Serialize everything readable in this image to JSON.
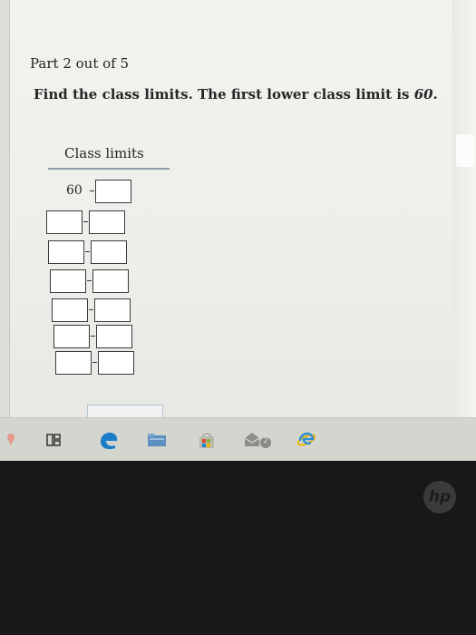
{
  "problem": {
    "part_label": "Part 2 out of 5",
    "question_text": "Find the class limits. The first lower class limit is ",
    "question_value": "60.",
    "table_header": "Class limits",
    "first_lower_limit": "60",
    "dash_glyph": "–"
  },
  "rows": [
    {
      "lower_prefilled": true,
      "upper_value": ""
    },
    {
      "lower_prefilled": false,
      "lower_value": "",
      "upper_value": ""
    },
    {
      "lower_prefilled": false,
      "lower_value": "",
      "upper_value": ""
    },
    {
      "lower_prefilled": false,
      "lower_value": "",
      "upper_value": ""
    },
    {
      "lower_prefilled": false,
      "lower_value": "",
      "upper_value": ""
    },
    {
      "lower_prefilled": false,
      "lower_value": "",
      "upper_value": ""
    },
    {
      "lower_prefilled": false,
      "lower_value": "",
      "upper_value": ""
    }
  ],
  "taskbar": {
    "icons": [
      "search-icon",
      "task-view-icon",
      "edge-icon",
      "file-explorer-icon",
      "store-icon",
      "mail-icon",
      "internet-explorer-icon"
    ],
    "mail_badge": "2"
  },
  "brand": {
    "logo_text": "hp"
  },
  "colors": {
    "accent": "#1a7fc8",
    "rule": "#8e9aa5"
  }
}
